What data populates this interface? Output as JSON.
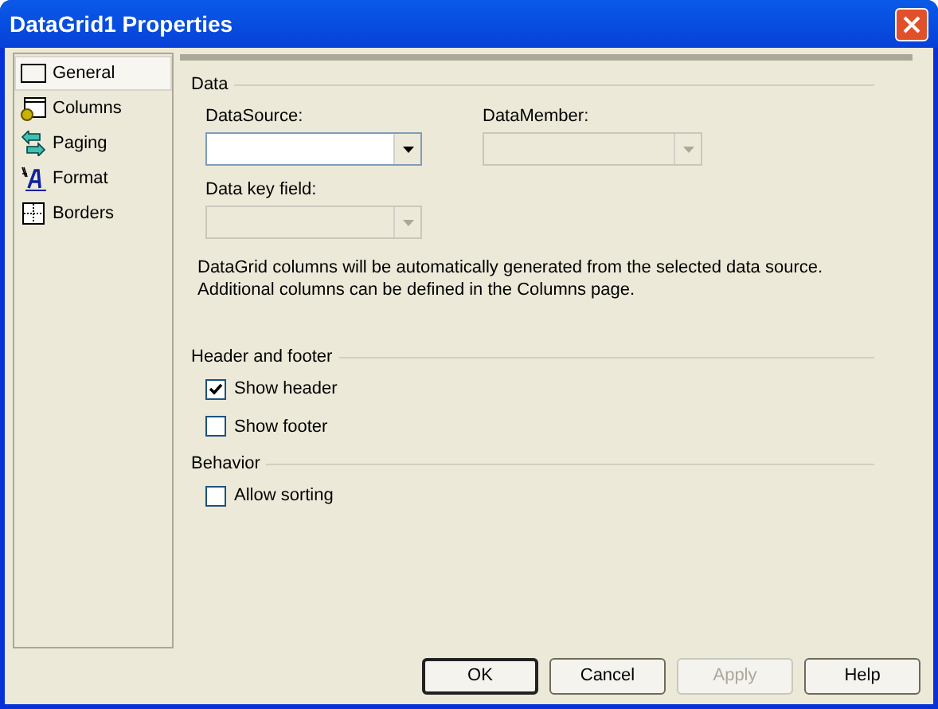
{
  "window": {
    "title": "DataGrid1 Properties"
  },
  "sidebar": {
    "items": [
      {
        "label": "General",
        "selected": true
      },
      {
        "label": "Columns",
        "selected": false
      },
      {
        "label": "Paging",
        "selected": false
      },
      {
        "label": "Format",
        "selected": false
      },
      {
        "label": "Borders",
        "selected": false
      }
    ]
  },
  "sections": [
    {
      "title": "Data",
      "fields": [
        {
          "label": "DataSource:",
          "disabled": false
        },
        {
          "label": "DataMember:",
          "disabled": true
        },
        {
          "label": "Data key field:",
          "disabled": true
        }
      ],
      "note": [
        "DataGrid columns will be automatically generated from the selected data source.",
        "Additional columns can be defined in the Columns page."
      ]
    },
    {
      "title": "Header and footer",
      "checkboxes": [
        {
          "label": "Show header",
          "checked": true
        },
        {
          "label": "Show footer",
          "checked": false
        }
      ]
    },
    {
      "title": "Behavior",
      "checkboxes": [
        {
          "label": "Allow sorting",
          "checked": false
        }
      ]
    }
  ],
  "buttons": [
    {
      "label": "OK",
      "default": true,
      "disabled": false
    },
    {
      "label": "Cancel",
      "default": false,
      "disabled": false
    },
    {
      "label": "Apply",
      "default": false,
      "disabled": true
    },
    {
      "label": "Help",
      "default": false,
      "disabled": false
    }
  ]
}
